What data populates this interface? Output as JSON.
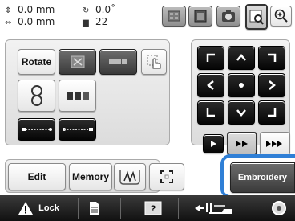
{
  "status": {
    "xy_value_1": "0.0 mm",
    "xy_value_2": "0.0 mm",
    "angle_value": "0.0˚",
    "thread_count": "22"
  },
  "left_panel": {
    "rotate_label": "Rotate"
  },
  "bottom_buttons": {
    "edit_label": "Edit",
    "memory_label": "Memory",
    "embroidery_label": "Embroidery"
  },
  "bottombar": {
    "lock_label": "Lock"
  },
  "colors": {
    "highlight": "#2f7fd6",
    "dark_button": "#3a3a3a",
    "bottombar": "#111111"
  }
}
